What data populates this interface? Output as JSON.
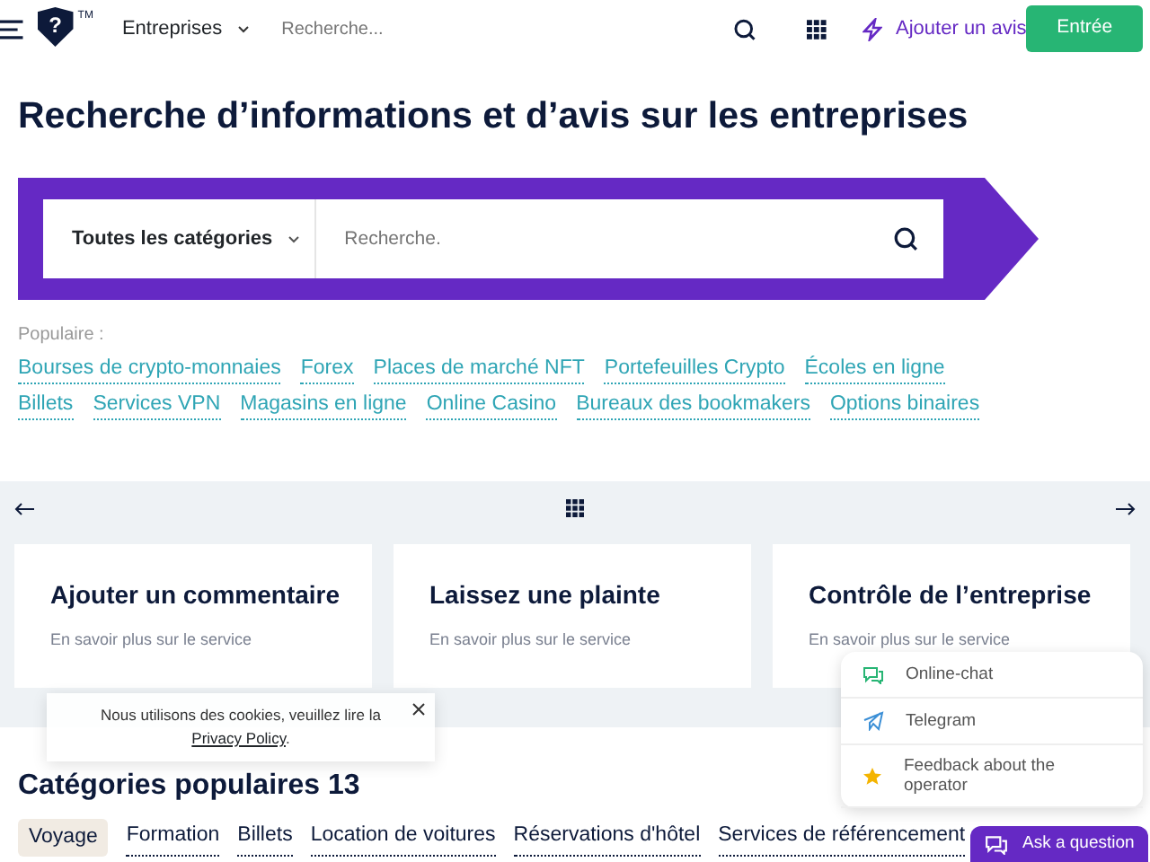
{
  "header": {
    "logo_mark": "?",
    "logo_tm": "TM",
    "menu_category": "Entreprises",
    "search_placeholder": "Recherche...",
    "add_review": "Ajouter un avis",
    "login": "Entrée"
  },
  "title": "Recherche d’informations et d’avis sur les entreprises",
  "search": {
    "category": "Toutes les catégories",
    "placeholder": "Recherche."
  },
  "popular": {
    "label": "Populaire :",
    "links": [
      "Bourses de crypto-monnaies",
      "Forex",
      "Places de marché NFT",
      "Portefeuilles Crypto",
      "Écoles en ligne",
      "Billets",
      "Services VPN",
      "Magasins en ligne",
      "Online Casino",
      "Bureaux des bookmakers",
      "Options binaires"
    ]
  },
  "services": [
    {
      "title": "Ajouter un commentaire",
      "subtitle": "En savoir plus sur le service"
    },
    {
      "title": "Laissez une plainte",
      "subtitle": "En savoir plus sur le service"
    },
    {
      "title": "Contrôle de l’entreprise",
      "subtitle": "En savoir plus sur le service"
    }
  ],
  "categories": {
    "heading": "Catégories populaires 13",
    "tags": [
      {
        "label": "Voyage",
        "selected": true
      },
      {
        "label": "Formation",
        "selected": false
      },
      {
        "label": "Billets",
        "selected": false
      },
      {
        "label": "Location de voitures",
        "selected": false
      },
      {
        "label": "Réservations d'hôtel",
        "selected": false
      },
      {
        "label": "Services de référencement",
        "selected": false
      }
    ]
  },
  "cookie": {
    "text": "Nous utilisons des cookies, veuillez lire la",
    "link": "Privacy Policy",
    "end": "."
  },
  "support": {
    "options": [
      {
        "kind": "chat",
        "label": "Online-chat"
      },
      {
        "kind": "telegram",
        "label": "Telegram"
      },
      {
        "kind": "feedback",
        "label": "Feedback about the operator"
      }
    ],
    "button": "Ask a question"
  }
}
